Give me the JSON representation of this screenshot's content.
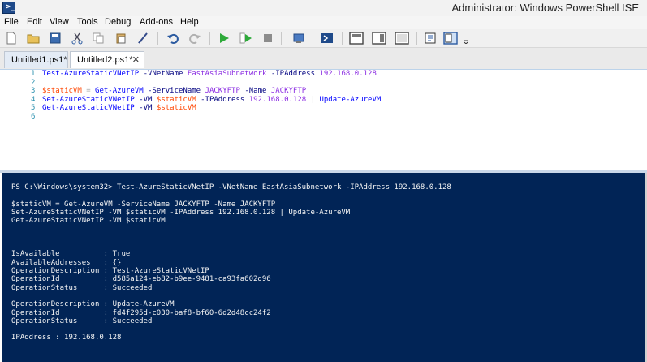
{
  "window": {
    "title": "Administrator: Windows PowerShell ISE",
    "app_glyph": ">_"
  },
  "menu": [
    "File",
    "Edit",
    "View",
    "Tools",
    "Debug",
    "Add-ons",
    "Help"
  ],
  "tabs": [
    {
      "label": "Untitled1.ps1*",
      "active": false
    },
    {
      "label": "Untitled2.ps1*",
      "active": true,
      "close": "✕"
    }
  ],
  "editor": {
    "line_numbers": [
      "1",
      "2",
      "3",
      "4",
      "5",
      "6"
    ],
    "lines": [
      [
        {
          "t": "Test-AzureStaticVNetIP",
          "c": "cmd"
        },
        {
          "t": " ",
          "c": ""
        },
        {
          "t": "-VNetName",
          "c": "par"
        },
        {
          "t": " ",
          "c": ""
        },
        {
          "t": "EastAsiaSubnetwork",
          "c": "arg"
        },
        {
          "t": " ",
          "c": ""
        },
        {
          "t": "-IPAddress",
          "c": "par"
        },
        {
          "t": " ",
          "c": ""
        },
        {
          "t": "192.168.0.128",
          "c": "arg"
        }
      ],
      [],
      [
        {
          "t": "$staticVM",
          "c": "var"
        },
        {
          "t": " = ",
          "c": "op"
        },
        {
          "t": "Get-AzureVM",
          "c": "cmd"
        },
        {
          "t": " ",
          "c": ""
        },
        {
          "t": "-ServiceName",
          "c": "par"
        },
        {
          "t": " ",
          "c": ""
        },
        {
          "t": "JACKYFTP",
          "c": "arg"
        },
        {
          "t": " ",
          "c": ""
        },
        {
          "t": "-Name",
          "c": "par"
        },
        {
          "t": " ",
          "c": ""
        },
        {
          "t": "JACKYFTP",
          "c": "arg"
        }
      ],
      [
        {
          "t": "Set-AzureStaticVNetIP",
          "c": "cmd"
        },
        {
          "t": " ",
          "c": ""
        },
        {
          "t": "-VM",
          "c": "par"
        },
        {
          "t": " ",
          "c": ""
        },
        {
          "t": "$staticVM",
          "c": "var"
        },
        {
          "t": " ",
          "c": ""
        },
        {
          "t": "-IPAddress",
          "c": "par"
        },
        {
          "t": " ",
          "c": ""
        },
        {
          "t": "192.168.0.128",
          "c": "arg"
        },
        {
          "t": " | ",
          "c": "op"
        },
        {
          "t": "Update-AzureVM",
          "c": "cmd"
        }
      ],
      [
        {
          "t": "Get-AzureStaticVNetIP",
          "c": "cmd"
        },
        {
          "t": " ",
          "c": ""
        },
        {
          "t": "-VM",
          "c": "par"
        },
        {
          "t": " ",
          "c": ""
        },
        {
          "t": "$staticVM",
          "c": "var"
        }
      ],
      []
    ]
  },
  "console": {
    "lines": [
      "PS C:\\Windows\\system32> Test-AzureStaticVNetIP -VNetName EastAsiaSubnetwork -IPAddress 192.168.0.128",
      "",
      "$staticVM = Get-AzureVM -ServiceName JACKYFTP -Name JACKYFTP",
      "Set-AzureStaticVNetIP -VM $staticVM -IPAddress 192.168.0.128 | Update-AzureVM",
      "Get-AzureStaticVNetIP -VM $staticVM",
      "",
      "",
      "",
      "IsAvailable          : True",
      "AvailableAddresses   : {}",
      "OperationDescription : Test-AzureStaticVNetIP",
      "OperationId          : d585a124-eb82-b9ee-9481-ca93fa602d96",
      "OperationStatus      : Succeeded",
      "",
      "OperationDescription : Update-AzureVM",
      "OperationId          : fd4f295d-c030-baf8-bf60-6d2d48cc24f2",
      "OperationStatus      : Succeeded",
      "",
      "IPAddress : 192.168.0.128"
    ]
  },
  "toolbar": {
    "icons": [
      "new-icon",
      "open-icon",
      "save-icon",
      "cut-icon",
      "copy-icon",
      "paste-icon",
      "clear-console-icon",
      "undo-icon",
      "redo-icon",
      "run-script-icon",
      "run-selection-icon",
      "stop-icon",
      "new-remote-tab-icon",
      "start-powershell-icon",
      "show-script-top-icon",
      "show-script-right-icon",
      "show-script-max-icon",
      "show-commands-icon",
      "show-addon-icon",
      "toolbar-overflow-icon"
    ]
  }
}
